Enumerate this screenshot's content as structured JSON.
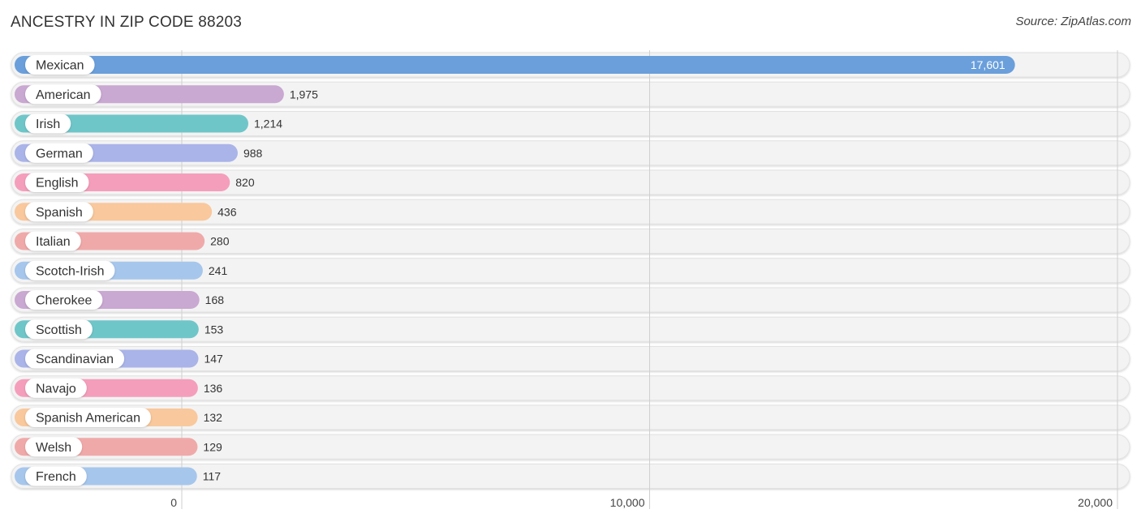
{
  "header": {
    "title": "ANCESTRY IN ZIP CODE 88203",
    "source": "Source: ZipAtlas.com"
  },
  "chart_data": {
    "type": "bar",
    "orientation": "horizontal",
    "title": "ANCESTRY IN ZIP CODE 88203",
    "xlabel": "",
    "ylabel": "",
    "xlim": [
      0,
      20000
    ],
    "xticks": [
      0,
      10000,
      20000
    ],
    "xtick_labels": [
      "0",
      "10,000",
      "20,000"
    ],
    "grid": true,
    "legend": "none",
    "categories": [
      "Mexican",
      "American",
      "Irish",
      "German",
      "English",
      "Spanish",
      "Italian",
      "Scotch-Irish",
      "Cherokee",
      "Scottish",
      "Scandinavian",
      "Navajo",
      "Spanish American",
      "Welsh",
      "French"
    ],
    "values": [
      17601,
      1975,
      1214,
      988,
      820,
      436,
      280,
      241,
      168,
      153,
      147,
      136,
      132,
      129,
      117
    ],
    "value_labels": [
      "17,601",
      "1,975",
      "1,214",
      "988",
      "820",
      "436",
      "280",
      "241",
      "168",
      "153",
      "147",
      "136",
      "132",
      "129",
      "117"
    ],
    "colors": [
      "#6a9fdb",
      "#c9a8d2",
      "#6fc6c9",
      "#aab4e8",
      "#f59ebb",
      "#f9c89c",
      "#f0a9a9",
      "#a6c6ec",
      "#c9a8d2",
      "#6fc6c9",
      "#aab4e8",
      "#f59ebb",
      "#f9c89c",
      "#f0a9a9",
      "#a6c6ec"
    ]
  }
}
